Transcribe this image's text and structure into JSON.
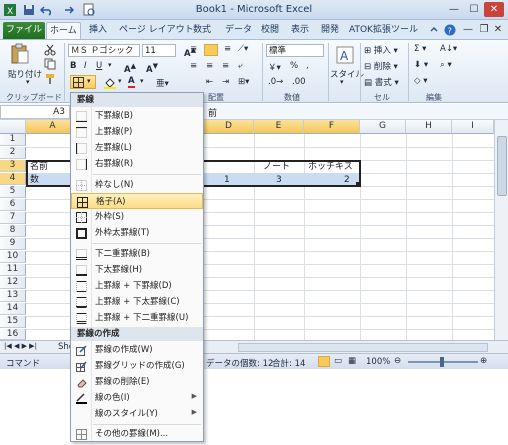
{
  "window": {
    "title": "Book1 - Microsoft Excel"
  },
  "tabs": [
    "ファイル",
    "ホーム",
    "挿入",
    "ページ レイアウト",
    "数式",
    "データ",
    "校閲",
    "表示",
    "開発",
    "ATOK拡張ツール"
  ],
  "ribbon": {
    "paste_label": "貼り付け",
    "font_name": "ＭＳ Ｐゴシック",
    "font_size": "11",
    "number_format": "標準",
    "style_label": "スタイル",
    "insert_label": "挿入",
    "delete_label": "削除",
    "format_label": "書式",
    "groups": {
      "clipboard": "クリップボード",
      "alignment": "配置",
      "number": "数値",
      "cells": "セル",
      "editing": "編集"
    }
  },
  "formula_bar": {
    "name_box": "A3",
    "content": "前"
  },
  "columns": [
    "A",
    "D",
    "E",
    "F",
    "G",
    "H",
    "I"
  ],
  "rows": [
    "1",
    "2",
    "3",
    "4",
    "5",
    "6",
    "7",
    "8",
    "9",
    "10",
    "11",
    "12",
    "13",
    "14",
    "15",
    "16"
  ],
  "cells": {
    "a3": "名前",
    "a4": "数",
    "e3": "ノート",
    "f3": "ホッチキス",
    "d4": "1",
    "e4": "3",
    "f4": "2"
  },
  "sheet_tab_partial": "She",
  "status": {
    "mode": "コマンド",
    "count": "データの個数: 12",
    "sum": "合計: 14",
    "zoom": "100%"
  },
  "menu": {
    "section_borders": "罫線",
    "section_draw": "罫線の作成",
    "items_a": [
      {
        "label": "下罫線(B)",
        "icon": "border-bottom-icon"
      },
      {
        "label": "上罫線(P)",
        "icon": "border-top-icon"
      },
      {
        "label": "左罫線(L)",
        "icon": "border-left-icon"
      },
      {
        "label": "右罫線(R)",
        "icon": "border-right-icon"
      }
    ],
    "items_b": [
      {
        "label": "枠なし(N)",
        "icon": "no-border-icon"
      },
      {
        "label": "格子(A)",
        "icon": "all-borders-icon"
      },
      {
        "label": "外枠(S)",
        "icon": "outside-border-icon"
      },
      {
        "label": "外枠太罫線(T)",
        "icon": "thick-box-border-icon"
      }
    ],
    "items_c": [
      {
        "label": "下二重罫線(B)",
        "icon": "double-bottom-border-icon"
      },
      {
        "label": "下太罫線(H)",
        "icon": "thick-bottom-border-icon"
      },
      {
        "label": "上罫線 + 下罫線(D)",
        "icon": "top-bottom-border-icon"
      },
      {
        "label": "上罫線 + 下太罫線(C)",
        "icon": "top-thick-bottom-border-icon"
      },
      {
        "label": "上罫線 + 下二重罫線(U)",
        "icon": "top-double-bottom-border-icon"
      }
    ],
    "items_draw": [
      {
        "label": "罫線の作成(W)",
        "icon": "draw-border-icon"
      },
      {
        "label": "罫線グリッドの作成(G)",
        "icon": "draw-border-grid-icon"
      },
      {
        "label": "罫線の削除(E)",
        "icon": "erase-border-icon"
      },
      {
        "label": "線の色(I)",
        "icon": "line-color-icon"
      },
      {
        "label": "線のスタイル(Y)",
        "icon": "line-style-icon"
      }
    ],
    "more": {
      "label": "その他の罫線(M)...",
      "icon": "more-borders-icon"
    }
  }
}
